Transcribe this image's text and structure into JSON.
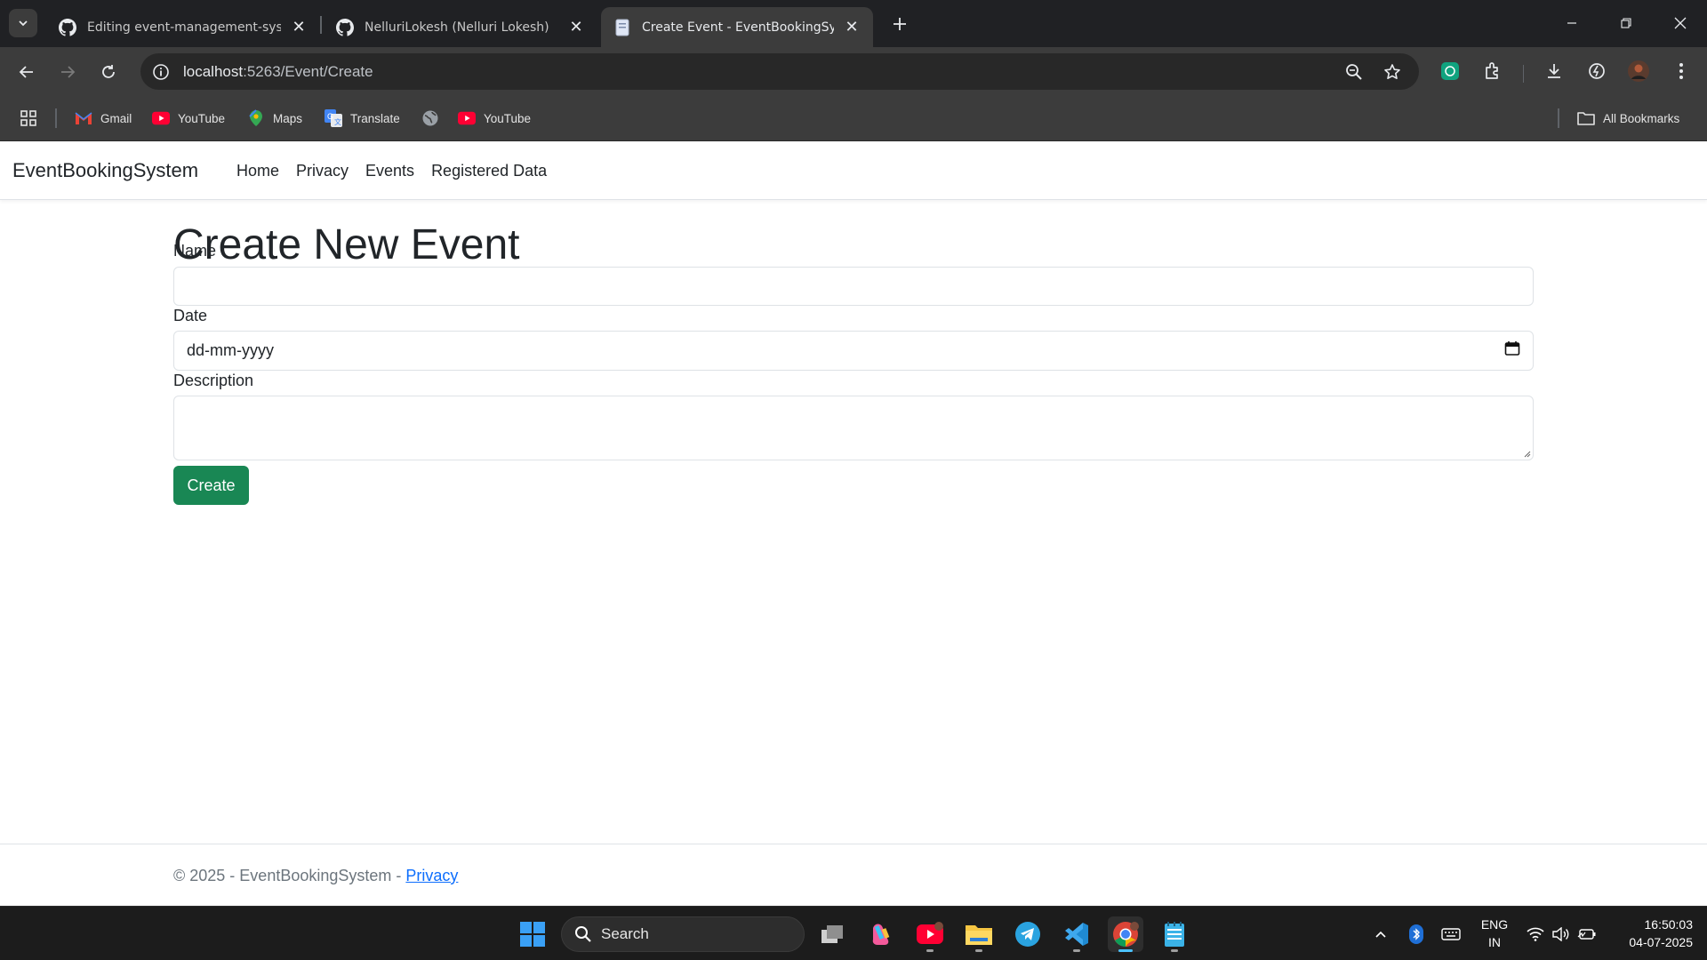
{
  "browser": {
    "tabs": [
      {
        "title": "Editing event-management-syste",
        "icon": "github-icon",
        "active": false
      },
      {
        "title": "NelluriLokesh (Nelluri Lokesh)",
        "icon": "github-icon",
        "active": false
      },
      {
        "title": "Create Event - EventBookingSyst",
        "icon": "page-icon",
        "active": true
      }
    ],
    "url_host": "localhost",
    "url_rest": ":5263/Event/Create",
    "bookmarks": [
      {
        "label": "Gmail",
        "icon": "gmail-icon"
      },
      {
        "label": "YouTube",
        "icon": "youtube-icon"
      },
      {
        "label": "Maps",
        "icon": "maps-icon"
      },
      {
        "label": "Translate",
        "icon": "translate-icon"
      },
      {
        "label": "",
        "icon": "globe-icon"
      },
      {
        "label": "YouTube",
        "icon": "youtube-icon"
      }
    ],
    "all_bookmarks": "All Bookmarks"
  },
  "site": {
    "brand": "EventBookingSystem",
    "nav": [
      "Home",
      "Privacy",
      "Events",
      "Registered Data"
    ]
  },
  "form": {
    "title": "Create New Event",
    "name_label": "Name",
    "name_value": "",
    "date_label": "Date",
    "date_placeholder": "dd-mm-yyyy",
    "description_label": "Description",
    "description_value": "",
    "submit_label": "Create"
  },
  "footer": {
    "copyright": "© 2025 - EventBookingSystem - ",
    "privacy_link": "Privacy"
  },
  "taskbar": {
    "search_label": "Search",
    "language_line1": "ENG",
    "language_line2": "IN",
    "time": "16:50:03",
    "date": "04-07-2025"
  },
  "colors": {
    "create_button": "#198754",
    "link": "#0d6efd",
    "chrome_dark": "#202124",
    "taskbar": "#1c1c1c"
  }
}
